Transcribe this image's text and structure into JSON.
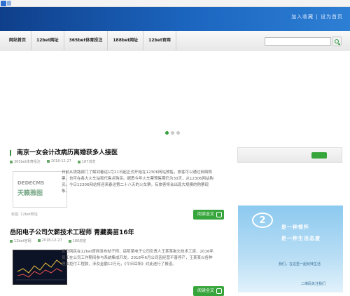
{
  "header": {
    "top_links": "加入收藏 | 设为首页"
  },
  "nav": {
    "items": [
      "网站首页",
      "12bet网址",
      "365bet体育投注",
      "188bet网址",
      "12bet官网"
    ]
  },
  "articles": [
    {
      "title": "南京一女会计改病历离婚获多人接医",
      "meta": [
        "365bet体育投注",
        "2018-12-27",
        "187浏览"
      ],
      "thumb_top": "DEDECMS",
      "thumb_bottom": "天籁雅图",
      "excerpt": "日前从铁路部门了解到春运1月21日起正式开始在12306网站预售，旅客可以通过网络购票，也可在各大火车站和代售点购买。据悉今年火车票预售期仍为30天，从12306网站购买。今日12306网站将迎来春运第二十八天的火车票。有旅客将会出现大规模的购票现象。",
      "tags": "标签: 12bet网址",
      "more_label": "阅读全文"
    },
    {
      "title": "岳阳电子公司欠薪技术工程师 青藏奏苗16年",
      "meta": [
        "12bet官网",
        "2018-12-27",
        "180浏览"
      ],
      "excerpt": "近日网民在12bet官网发布帖子称，岳阳某电子公司负责人王某某拖欠技术工资，2016年员工在公司工作期间参与系统集成开发，2018年6月公司因经营不善停产，王某某以各种理由拒付工程款，涉及金额12万元，《今日岳阳》对此进行了报道。",
      "more_label": "阅读全文"
    }
  ],
  "ad": {
    "bubble": "2",
    "line1": "是一种情怀",
    "line2": "是一种生活态度",
    "line3": "我们，在这里一起玩味生活",
    "line4": "二维码关注我们"
  },
  "colors": {
    "header": "#1c66c0",
    "accent": "#36a53b"
  }
}
